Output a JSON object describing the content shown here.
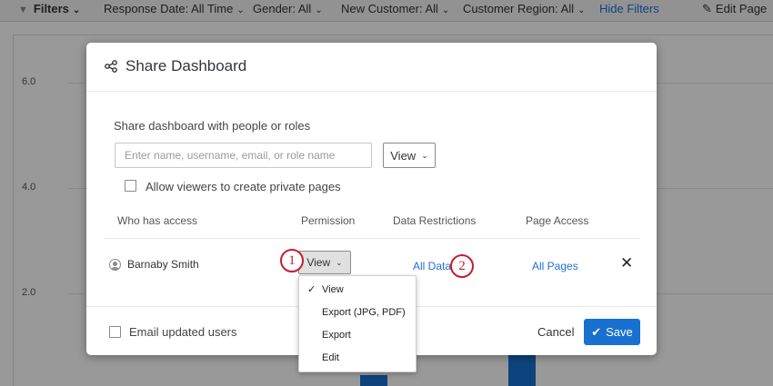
{
  "filter_bar": {
    "filters_label": "Filters",
    "items": [
      "Response Date: All Time",
      "Gender: All",
      "New Customer: All",
      "Customer Region: All"
    ],
    "hide_filters": "Hide Filters",
    "edit_page": "Edit Page"
  },
  "chart": {
    "y_ticks": [
      "6.0",
      "4.0",
      "2.0"
    ],
    "bar_color": "#1871d0"
  },
  "modal": {
    "title": "Share Dashboard",
    "subtitle": "Share dashboard with people or roles",
    "search_placeholder": "Enter name, username, email, or role name",
    "default_permission": "View",
    "allow_private_pages": "Allow viewers to create private pages",
    "columns": {
      "who": "Who has access",
      "permission": "Permission",
      "data_restrictions": "Data Restrictions",
      "page_access": "Page Access"
    },
    "row": {
      "name": "Barnaby Smith",
      "permission": "View",
      "data_restriction": "All Data",
      "page_access": "All Pages"
    },
    "email_updated_users": "Email updated users",
    "cancel": "Cancel",
    "save": "Save"
  },
  "permission_dropdown": {
    "selected": "View",
    "options": [
      "View",
      "Export (JPG, PDF)",
      "Export",
      "Edit"
    ]
  },
  "callouts": [
    "1",
    "2"
  ],
  "colors": {
    "accent": "#1871d0",
    "link": "#1e6fd9",
    "callout": "#c41e2e"
  }
}
